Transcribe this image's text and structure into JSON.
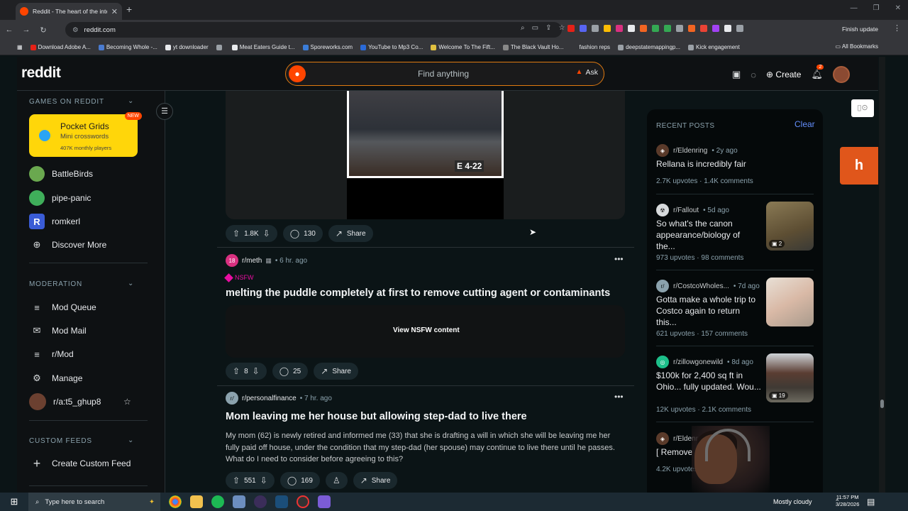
{
  "browser": {
    "tab_title": "Reddit - The heart of the intern",
    "url": "reddit.com",
    "finish_update": "Finish update",
    "bookmarks": [
      {
        "label": "Download Adobe A...",
        "color": "#e62117"
      },
      {
        "label": "Becoming Whole -...",
        "color": "#4a7bd0"
      },
      {
        "label": "yt downloader",
        "color": "#e8eaed"
      },
      {
        "label": "",
        "color": "#9aa0a6"
      },
      {
        "label": "Meat Eaters Guide t...",
        "color": "#e8eaed"
      },
      {
        "label": "Sporeworks.com",
        "color": "#3b7dd8"
      },
      {
        "label": "YouTube to Mp3 Co...",
        "color": "#2a6ad8"
      },
      {
        "label": "Welcome To The Fift...",
        "color": "#e0c040"
      },
      {
        "label": "The Black Vault Ho...",
        "color": "#888888"
      },
      {
        "label": "fashion reps",
        "color": "#35363a"
      },
      {
        "label": "deepstatemappingp...",
        "color": "#9aa0a6"
      },
      {
        "label": "Kick engagement",
        "color": "#9aa0a6"
      }
    ],
    "all_bookmarks": "All Bookmarks"
  },
  "header": {
    "logo": "reddit",
    "search_placeholder": "Find anything",
    "ask_label": "Ask",
    "create_label": "Create",
    "notif_count": "2"
  },
  "sidebar": {
    "games_heading": "GAMES ON REDDIT",
    "pocket_grids": {
      "title": "Pocket Grids",
      "subtitle": "Mini crosswords",
      "players": "407K monthly players",
      "badge": "NEW"
    },
    "games": [
      {
        "label": "BattleBirds",
        "color": "#6aa84f"
      },
      {
        "label": "pipe-panic",
        "color": "#3fae5a"
      },
      {
        "label": "romkerl",
        "color": "#3a5cd6"
      },
      {
        "label": "Discover More",
        "color": "transparent"
      }
    ],
    "moderation_heading": "MODERATION",
    "moderation": [
      {
        "label": "Mod Queue",
        "icon": "≡"
      },
      {
        "label": "Mod Mail",
        "icon": "✉"
      },
      {
        "label": "r/Mod",
        "icon": "≡"
      },
      {
        "label": "Manage",
        "icon": "⚙"
      },
      {
        "label": "r/a:t5_ghup8",
        "icon": ""
      }
    ],
    "custom_heading": "CUSTOM FEEDS",
    "create_feed": "Create Custom Feed"
  },
  "feed": {
    "post1_actions": {
      "votes": "1.8K",
      "comments": "130",
      "share": "Share"
    },
    "video_sign": "E 4-22",
    "post2": {
      "subreddit": "r/meth",
      "time": "6 hr. ago",
      "nsfw": "NSFW",
      "title": "melting the puddle completely at first to remove cutting agent or contaminants",
      "nsfw_button": "View NSFW content",
      "votes": "8",
      "comments": "25",
      "share": "Share"
    },
    "post3": {
      "subreddit": "r/personalfinance",
      "time": "7 hr. ago",
      "title": "Mom leaving me her house but allowing step-dad to live there",
      "body": "My mom (62) is newly retired and informed me (33) that she is drafting a will in which she will be leaving me her fully paid off house, under the condition that my step-dad (her spouse) may continue to live there until he passes. What do I need to consider before agreeing to this?",
      "votes": "551",
      "comments": "169",
      "share": "Share"
    }
  },
  "recent_posts": {
    "heading": "RECENT POSTS",
    "clear": "Clear",
    "items": [
      {
        "sub": "r/Eldenring",
        "time": "2y ago",
        "title": "Rellana is incredibly fair",
        "upvotes": "2.7K upvotes",
        "comments": "1.4K comments",
        "icon_color": "#5a3a2a",
        "thumb": ""
      },
      {
        "sub": "r/Fallout",
        "time": "5d ago",
        "title": "So what's the canon appearance/biology of the...",
        "upvotes": "973 upvotes",
        "comments": "98 comments",
        "icon_color": "#d7dadc",
        "thumb": "2"
      },
      {
        "sub": "r/CostcoWholes...",
        "time": "7d ago",
        "title": "Gotta make a whole trip to Costco again to return this...",
        "upvotes": "621 upvotes",
        "comments": "157 comments",
        "icon_color": "#8ba2ad",
        "thumb": ""
      },
      {
        "sub": "r/zillowgonewild",
        "time": "8d ago",
        "title": "$100k for 2,400 sq ft in Ohio... fully updated. Wou...",
        "upvotes": "12K upvotes",
        "comments": "2.1K comments",
        "icon_color": "#1dbf8a",
        "thumb": "19"
      },
      {
        "sub": "r/Eldenr",
        "time": "",
        "title": "[ Remove",
        "upvotes": "4.2K upvotes",
        "comments": "",
        "icon_color": "#5a3a2a",
        "thumb": ""
      }
    ]
  },
  "taskbar": {
    "search_placeholder": "Type here to search",
    "weather": "Mostly cloudy",
    "time": "11:57 PM",
    "date": "3/28/2026"
  }
}
